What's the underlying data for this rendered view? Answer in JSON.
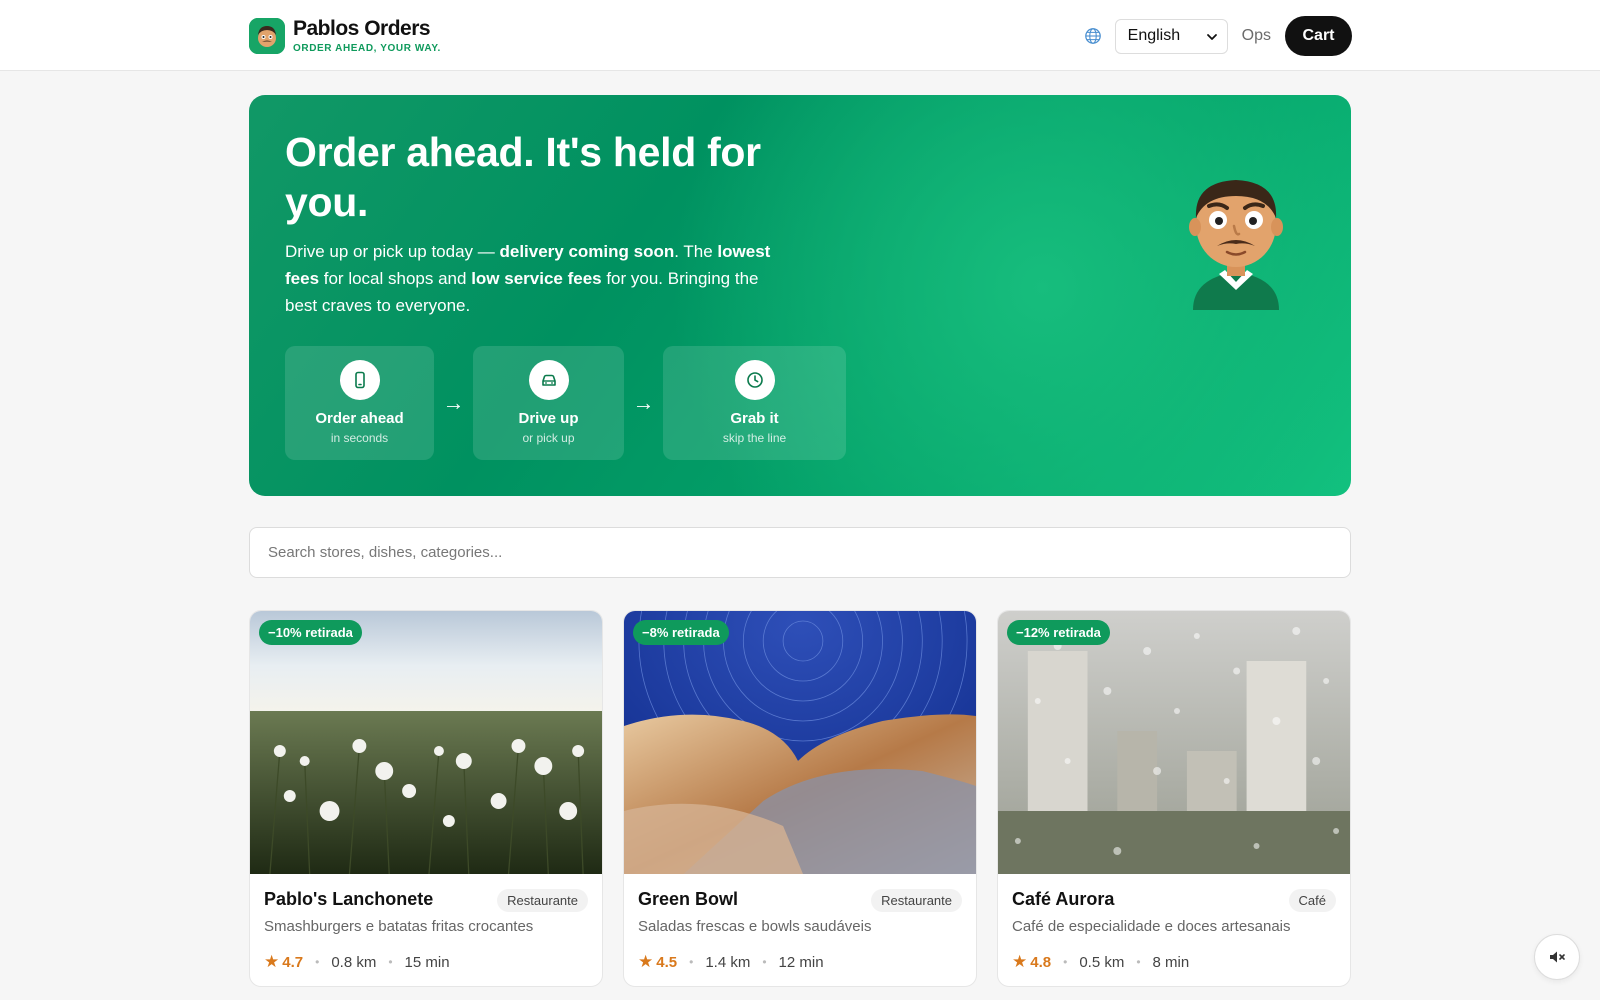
{
  "header": {
    "brand_title": "Pablos Orders",
    "brand_tagline": "ORDER AHEAD, YOUR WAY.",
    "language_selected": "English",
    "ops_label": "Ops",
    "cart_label": "Cart",
    "logo_icon": "mascot-face-icon",
    "language_icon": "globe-icon"
  },
  "hero": {
    "title": "Order ahead. It's held for you.",
    "desc_1": "Drive up or pick up today — ",
    "desc_bold_1": "delivery coming soon",
    "desc_2": ". The ",
    "desc_bold_2": "lowest fees",
    "desc_3": " for local shops and ",
    "desc_bold_3": "low service fees",
    "desc_4": " for you. Bringing the best craves to everyone.",
    "steps": [
      {
        "label": "Order ahead",
        "sub": "in seconds",
        "icon": "phone-icon"
      },
      {
        "label": "Drive up",
        "sub": "or pick up",
        "icon": "car-icon"
      },
      {
        "label": "Grab it",
        "sub": "skip the line",
        "icon": "clock-icon"
      }
    ],
    "arrow": "→"
  },
  "search": {
    "placeholder": "Search stores, dishes, categories..."
  },
  "stores": [
    {
      "badge": "−10% retirada",
      "name": "Pablo's Lanchonete",
      "category": "Restaurante",
      "description": "Smashburgers e batatas fritas crocantes",
      "rating": "4.7",
      "distance": "0.8 km",
      "time": "15 min"
    },
    {
      "badge": "−8% retirada",
      "name": "Green Bowl",
      "category": "Restaurante",
      "description": "Saladas frescas e bowls saudáveis",
      "rating": "4.5",
      "distance": "1.4 km",
      "time": "12 min"
    },
    {
      "badge": "−12% retirada",
      "name": "Café Aurora",
      "category": "Café",
      "description": "Café de especialidade e doces artesanais",
      "rating": "4.8",
      "distance": "0.5 km",
      "time": "8 min"
    }
  ],
  "common": {
    "star": "★",
    "dot": "•"
  },
  "colors": {
    "brand_green": "#0f9a5c",
    "hero_green": "#009160",
    "rating_orange": "#d9791c",
    "cart_bg": "#111111"
  },
  "mute_icon": "speaker-muted-icon"
}
